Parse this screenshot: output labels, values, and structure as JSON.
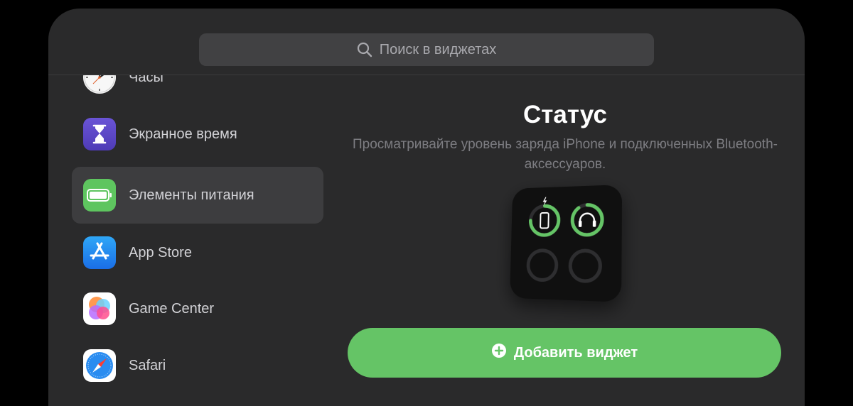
{
  "search": {
    "placeholder": "Поиск в виджетах",
    "icon": "search-icon"
  },
  "apps": [
    {
      "label": "Часы",
      "icon": "clock-icon"
    },
    {
      "label": "Экранное время",
      "icon": "hourglass-icon"
    },
    {
      "label": "Элементы питания",
      "icon": "battery-icon",
      "selected": true
    },
    {
      "label": "App Store",
      "icon": "app-store-icon"
    },
    {
      "label": "Game Center",
      "icon": "game-center-icon"
    },
    {
      "label": "Safari",
      "icon": "compass-icon"
    }
  ],
  "detail": {
    "title": "Статус",
    "description": "Просматривайте уровень заряда iPhone и подключенных Bluetooth-аксессуаров.",
    "widget": {
      "devices": [
        {
          "icon": "iphone-icon",
          "charging": true,
          "level": 0.75
        },
        {
          "icon": "headphones-icon",
          "charging": false,
          "level": 0.9
        },
        {
          "icon": "empty-slot",
          "level": 0
        },
        {
          "icon": "empty-slot",
          "level": 0
        }
      ]
    },
    "add_button": {
      "label": "Добавить виджет",
      "icon": "plus-circle-icon"
    }
  },
  "colors": {
    "accent": "#65c466",
    "panel": "#2a2a2b",
    "selected_row": "#3d3d3f"
  }
}
